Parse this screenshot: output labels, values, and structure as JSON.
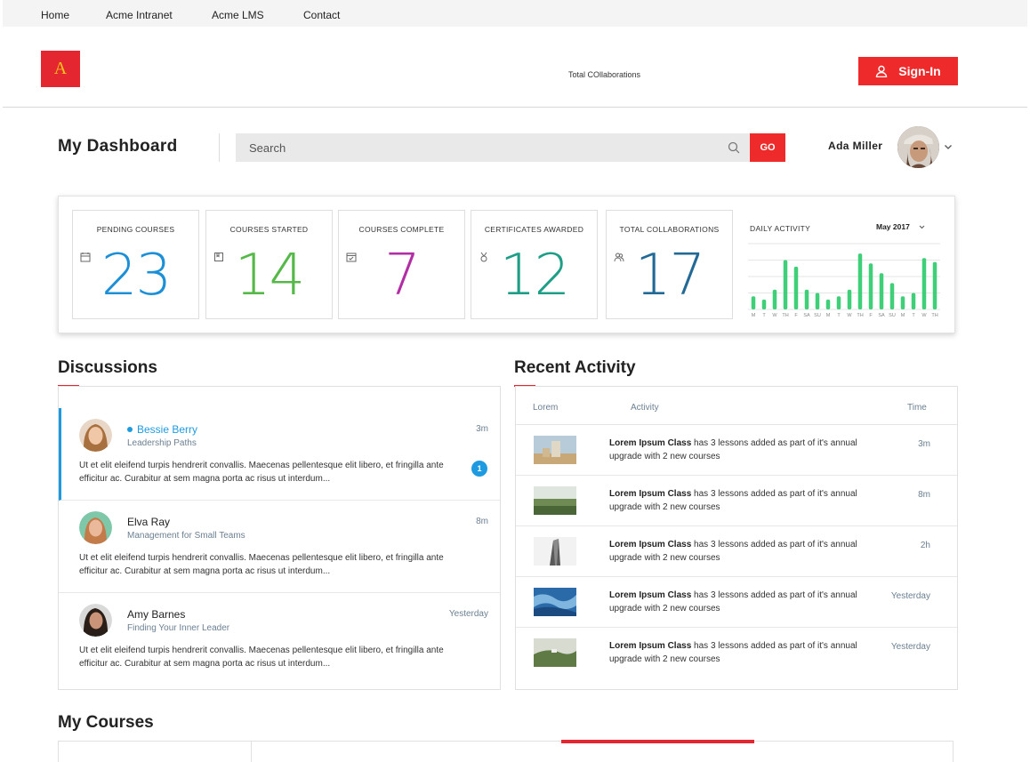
{
  "nav": {
    "items": [
      "Home",
      "Acme Intranet",
      "Acme LMS",
      "Contact"
    ]
  },
  "header": {
    "logo_letter": "A",
    "total_label": "Total COllaborations",
    "signin_label": "Sign-In"
  },
  "dashboard": {
    "title": "My Dashboard",
    "search_placeholder": "Search",
    "go_label": "GO",
    "user_name": "Ada Miller"
  },
  "stats": [
    {
      "label": "PENDING COURSES",
      "value": "23",
      "color": "#1c8fd6",
      "icon": "calendar-icon"
    },
    {
      "label": "COURSES STARTED",
      "value": "14",
      "color": "#55b848",
      "icon": "book-icon"
    },
    {
      "label": "COURSES COMPLETE",
      "value": "7",
      "color": "#b22ea5",
      "icon": "checklist-icon"
    },
    {
      "label": "CERTIFICATES AWARDED",
      "value": "12",
      "color": "#1e9e86",
      "icon": "medal-icon"
    },
    {
      "label": "TOTAL COLLABORATIONS",
      "value": "17",
      "color": "#226a95",
      "icon": "users-icon"
    }
  ],
  "daily_activity": {
    "label": "DAILY ACTIVITY",
    "month": "May 2017",
    "bar_color": "#3fcf78"
  },
  "chart_data": {
    "type": "bar",
    "categories": [
      "M",
      "T",
      "W",
      "TH",
      "F",
      "SA",
      "SU",
      "M",
      "T",
      "W",
      "TH",
      "F",
      "SA",
      "SU",
      "M",
      "T",
      "W",
      "TH"
    ],
    "values": [
      2,
      1.5,
      3,
      7.5,
      6.5,
      3,
      2.5,
      1.5,
      2,
      3,
      8.5,
      7,
      5.5,
      4,
      2,
      2.5,
      7.8,
      7.2
    ],
    "ylim": [
      0,
      10
    ],
    "grid": true
  },
  "discussions": {
    "title": "Discussions",
    "items": [
      {
        "name": "Bessie Berry",
        "subtitle": "Leadership Paths",
        "time": "3m",
        "text": "Ut et elit eleifend turpis hendrerit convallis. Maecenas pellentesque elit libero, et fringilla ante efficitur ac. Curabitur at sem magna porta ac risus ut interdum...",
        "badge": "1"
      },
      {
        "name": "Elva Ray",
        "subtitle": "Management for Small Teams",
        "time": "8m",
        "text": "Ut et elit eleifend turpis hendrerit convallis. Maecenas pellentesque elit libero, et fringilla ante efficitur ac. Curabitur at sem magna porta ac risus ut interdum..."
      },
      {
        "name": "Amy Barnes",
        "subtitle": "Finding Your Inner Leader",
        "time": "Yesterday",
        "text": "Ut et elit eleifend turpis hendrerit convallis. Maecenas pellentesque elit libero, et fringilla ante efficitur ac. Curabitur at sem magna porta ac risus ut interdum..."
      }
    ]
  },
  "recent_activity": {
    "title": "Recent Activity",
    "columns": [
      "Lorem",
      "Activity",
      "Time"
    ],
    "rows": [
      {
        "bold": "Lorem Ipsum Class",
        "text": " has 3 lessons added as part of it's annual upgrade with 2 new courses",
        "time": "3m"
      },
      {
        "bold": "Lorem Ipsum Class",
        "text": " has 3 lessons added as part of it's annual upgrade with 2 new courses",
        "time": "8m"
      },
      {
        "bold": "Lorem Ipsum Class",
        "text": " has 3 lessons added as part of it's annual upgrade with 2 new courses",
        "time": "2h"
      },
      {
        "bold": "Lorem Ipsum Class",
        "text": " has 3 lessons added as part of it's annual upgrade with 2 new courses",
        "time": "Yesterday"
      },
      {
        "bold": "Lorem Ipsum Class",
        "text": " has 3 lessons added as part of it's annual upgrade with 2 new courses",
        "time": "Yesterday"
      }
    ]
  },
  "courses": {
    "title": "My Courses"
  }
}
